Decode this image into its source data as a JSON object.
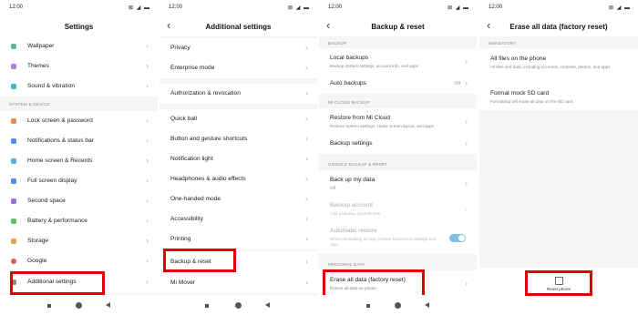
{
  "status": {
    "time": "12:00",
    "icons": "⊠ ◢ ▬"
  },
  "colors": {
    "highlight": "#e00000",
    "toggle": "#7ec0e8"
  },
  "settings": {
    "title": "Settings",
    "items_top": [
      "Wallpaper",
      "Themes",
      "Sound & vibration"
    ],
    "section_system": "SYSTEM & DEVICE",
    "items_system": [
      "Lock screen & password",
      "Notifications & status bar",
      "Home screen & Recents",
      "Full screen display",
      "Second space",
      "Battery & performance",
      "Storage",
      "Google",
      "Additional settings"
    ]
  },
  "additional": {
    "title": "Additional settings",
    "items": [
      "Privacy",
      "Enterprise mode",
      "Authorization & revocation",
      "Quick ball",
      "Button and gesture shortcuts",
      "Notification light",
      "Headphones & audio effects",
      "One-handed mode",
      "Accessibility",
      "Printing",
      "Backup & reset",
      "Mi Mover"
    ]
  },
  "backup": {
    "title": "Backup & reset",
    "section_backup": "BACKUP",
    "local_backups": "Local backups",
    "local_backups_sub": "Backup system settings, account info, and apps",
    "auto_backups": "Auto backups",
    "auto_backups_value": "Off",
    "section_cloud": "MI CLOUD BACKUP",
    "restore_cloud": "Restore from Mi Cloud",
    "restore_cloud_sub": "Restore system settings, Home screen layout, and apps",
    "backup_settings": "Backup settings",
    "section_google": "GOOGLE BACKUP & RESET",
    "back_up_data": "Back up my data",
    "back_up_data_sub": "Off",
    "backup_account": "Backup account",
    "backup_account_sub": "Add a backup account now",
    "auto_restore": "Automatic restore",
    "auto_restore_sub": "When reinstalling an app, restore backed-up settings and data",
    "section_personal": "PERSONAL DATA",
    "erase": "Erase all data (factory reset)",
    "erase_sub": "Erases all data on phone"
  },
  "erase": {
    "title": "Erase all data (factory reset)",
    "section_mandatory": "MANDATORY",
    "all_files": "All files on the phone",
    "all_files_sub": "All files and data, including accounts, contacts, photos, and apps",
    "format_sd": "Format mock SD card",
    "format_sd_sub": "Formatting will erase all data on the SD card",
    "reset_phone": "Reset phone"
  }
}
